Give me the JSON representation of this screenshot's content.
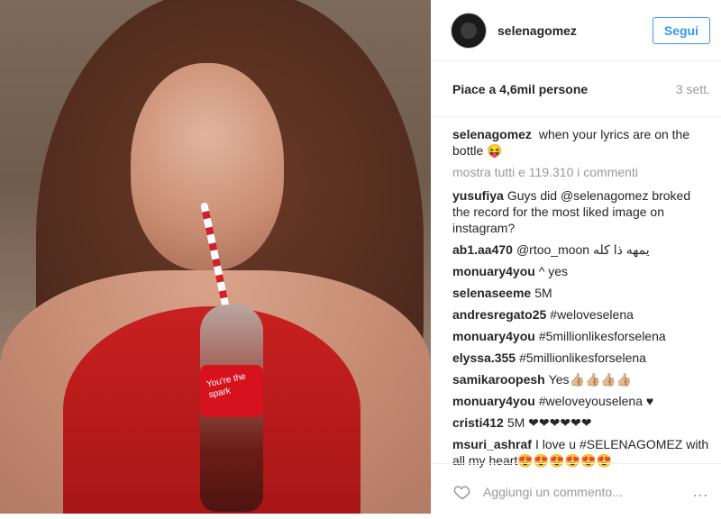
{
  "post": {
    "username": "selenagomez",
    "follow_label": "Segui",
    "likes_text": "Piace a 4,6mil persone",
    "time_text": "3 sett.",
    "caption_user": "selenagomez",
    "caption_text": "when your lyrics are on the bottle 😝",
    "view_all_comments": "mostra tutti e 119.310 i commenti",
    "comments": [
      {
        "user": "yusufiya",
        "text": "Guys did @selenagomez broked the record for the most liked image on instagram?"
      },
      {
        "user": "ab1.aa470",
        "text": "@rtoo_moon يمهه ذا كله"
      },
      {
        "user": "monuary4you",
        "text": "^ yes"
      },
      {
        "user": "selenaseeme",
        "text": "5M"
      },
      {
        "user": "andresregato25",
        "text": "#weloveselena"
      },
      {
        "user": "monuary4you",
        "text": "#5millionlikesforselena"
      },
      {
        "user": "elyssa.355",
        "text": "#5millionlikesforselena"
      },
      {
        "user": "samikaroopesh",
        "text": "Yes👍🏼👍🏼👍🏼👍🏼"
      },
      {
        "user": "monuary4you",
        "text": "#weloveyouselena ♥"
      },
      {
        "user": "cristi412",
        "text": "5M ❤❤❤❤❤❤"
      },
      {
        "user": "msuri_ashraf",
        "text": "I love u #SELENAGOMEZ with all my heart😍😍😍😍😍😍"
      }
    ],
    "add_comment_placeholder": "Aggiungi un commento...",
    "more_icon": "more-horizontal-icon",
    "heart_icon": "heart-outline-icon"
  },
  "photo": {
    "bottle_label": "You're the spark"
  }
}
